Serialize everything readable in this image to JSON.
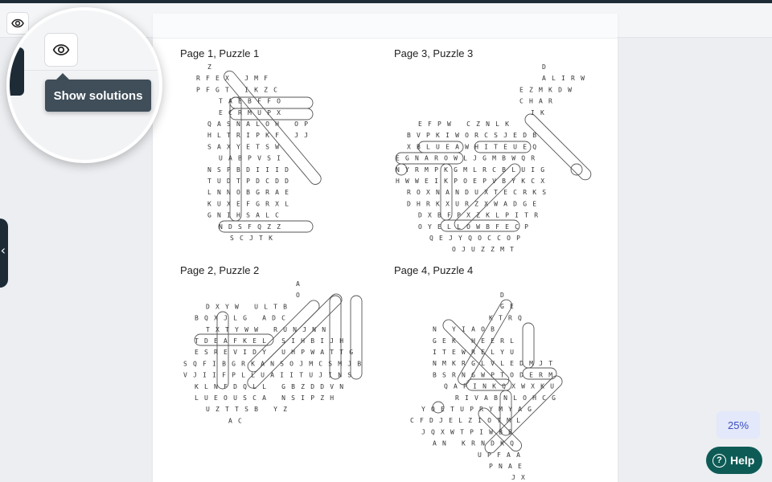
{
  "toolbar": {
    "eye_icon": "eye-icon"
  },
  "magnifier": {
    "tooltip": "Show solutions"
  },
  "left_tab": {
    "glyph": "‹"
  },
  "zoom": {
    "label": "25%"
  },
  "help": {
    "label": "Help",
    "glyph": "?"
  },
  "colors": {
    "teal": "#0e5b56",
    "navy": "#1d2b36",
    "tooltip": "#3f4e59",
    "zoom_bg": "#e3e8fb"
  },
  "puzzles": [
    {
      "id": "p1",
      "title": "Page 1, Puzzle 1",
      "rows": [
        {
          "c": 2,
          "r": 0,
          "t": "Z"
        },
        {
          "c": 1,
          "r": 1,
          "t": "RFEX    JMF"
        },
        {
          "c": 1,
          "r": 2,
          "t": "PFGT    IKZC"
        },
        {
          "c": 3,
          "r": 3,
          "t": "TAEBFFO"
        },
        {
          "c": 3,
          "r": 4,
          "t": "ECRMUPX"
        },
        {
          "c": 2,
          "r": 5,
          "t": "QASNALOH    OP"
        },
        {
          "c": 2,
          "r": 6,
          "t": "HLTRIPKF    JJ"
        },
        {
          "c": 2,
          "r": 7,
          "t": "SAXYETSW"
        },
        {
          "c": 3,
          "r": 8,
          "t": "UABPVSI"
        },
        {
          "c": 2,
          "r": 9,
          "t": "NSPBDIIID"
        },
        {
          "c": 2,
          "r": 10,
          "t": "TUDTPDCDD"
        },
        {
          "c": 2,
          "r": 11,
          "t": "LNNOBGRAE"
        },
        {
          "c": 2,
          "r": 12,
          "t": "KUXEFGRXL"
        },
        {
          "c": 2,
          "r": 13,
          "t": "GNIHSALC"
        },
        {
          "c": 3,
          "r": 14,
          "t": "NDSFQZZ"
        },
        {
          "c": 4,
          "r": 15,
          "t": "SCJTK"
        }
      ]
    },
    {
      "id": "p3",
      "title": "Page 3, Puzzle 3",
      "rows": [
        {
          "c": 13,
          "r": 0,
          "t": "D"
        },
        {
          "c": 13,
          "r": 1,
          "t": "ALIRW"
        },
        {
          "c": 11,
          "r": 2,
          "t": "EZMKDW"
        },
        {
          "c": 11,
          "r": 3,
          "t": "CHAR"
        },
        {
          "c": 12,
          "r": 4,
          "t": "IK"
        },
        {
          "c": 2,
          "r": 5,
          "t": "EFPW    CZNLK"
        },
        {
          "c": 1,
          "r": 6,
          "t": "BVPKIWORCSJEDB"
        },
        {
          "c": 1,
          "r": 7,
          "t": "XBLUEAWHITEUEQ"
        },
        {
          "c": 0,
          "r": 8,
          "t": "EGNAROWLJGMBWQR"
        },
        {
          "c": 0,
          "r": 9,
          "t": "NYRMPKGMLRCBLUIG"
        },
        {
          "c": 0,
          "r": 10,
          "t": "HWWEIKPOEPVBYKCX"
        },
        {
          "c": 1,
          "r": 11,
          "t": "ROXNANDUXTECRKS"
        },
        {
          "c": 1,
          "r": 12,
          "t": "DHRKXURZXWADGE"
        },
        {
          "c": 2,
          "r": 13,
          "t": "DXBFPXZKLPITR"
        },
        {
          "c": 2,
          "r": 14,
          "t": "OYELLOWBFECP"
        },
        {
          "c": 3,
          "r": 15,
          "t": "QEJYQOCCOP"
        },
        {
          "c": 5,
          "r": 16,
          "t": "OJUZZMT"
        }
      ]
    },
    {
      "id": "p2",
      "title": "Page 2, Puzzle 2",
      "rows": [
        {
          "c": 10,
          "r": 0,
          "t": "A"
        },
        {
          "c": 10,
          "r": 1,
          "t": "O"
        },
        {
          "c": 2,
          "r": 2,
          "t": "DXYW        ULTB"
        },
        {
          "c": 1,
          "r": 3,
          "t": "BQXJLG       ADC"
        },
        {
          "c": 2,
          "r": 4,
          "t": "TXTYWW     RUNJNN"
        },
        {
          "c": 1,
          "r": 5,
          "t": "TDEAFKEL   SIHBIJH"
        },
        {
          "c": 1,
          "r": 6,
          "t": "ESREVIDY UHPWATTG"
        },
        {
          "c": 0,
          "r": 7,
          "t": "SQFIBGRKANSOJMCSMJB"
        },
        {
          "c": 0,
          "r": 8,
          "t": "VJIIFPLLUAIITUJINS"
        },
        {
          "c": 1,
          "r": 9,
          "t": "KLNFDQLL  GBZDDVN"
        },
        {
          "c": 1,
          "r": 10,
          "t": "LUEOUSCA  NSIPZH"
        },
        {
          "c": 2,
          "r": 11,
          "t": "UZTTSB      YZ"
        },
        {
          "c": 4,
          "r": 12,
          "t": "AC"
        }
      ]
    },
    {
      "id": "p4",
      "title": "Page 4, Puzzle 4",
      "rows": [
        {
          "c": 8,
          "r": 0,
          "t": "D"
        },
        {
          "c": 8,
          "r": 1,
          "t": "GE"
        },
        {
          "c": 7,
          "r": 2,
          "t": "KTRQ"
        },
        {
          "c": 2,
          "r": 3,
          "t": "N    YIAOB"
        },
        {
          "c": 2,
          "r": 4,
          "t": "GEK  HEERL"
        },
        {
          "c": 2,
          "r": 5,
          "t": "ITEWRELYU"
        },
        {
          "c": 2,
          "r": 6,
          "t": "NMKRGLVLEDMJT"
        },
        {
          "c": 2,
          "r": 7,
          "t": "BSRNGWPTODERM"
        },
        {
          "c": 3,
          "r": 8,
          "t": "QAPINKQXWXKU"
        },
        {
          "c": 4,
          "r": 9,
          "t": "RIVABNLOHCG"
        },
        {
          "c": 1,
          "r": 10,
          "t": "YOETUPRYMYAG"
        },
        {
          "c": 0,
          "r": 11,
          "t": "CFDJELZIOTML"
        },
        {
          "c": 1,
          "r": 12,
          "t": "JQXWTPIWBB"
        },
        {
          "c": 2,
          "r": 13,
          "t": "AN KRNDKQ"
        },
        {
          "c": 6,
          "r": 14,
          "t": "UPFAA"
        },
        {
          "c": 7,
          "r": 15,
          "t": "PNAE"
        },
        {
          "c": 9,
          "r": 16,
          "t": "JX"
        }
      ]
    }
  ]
}
